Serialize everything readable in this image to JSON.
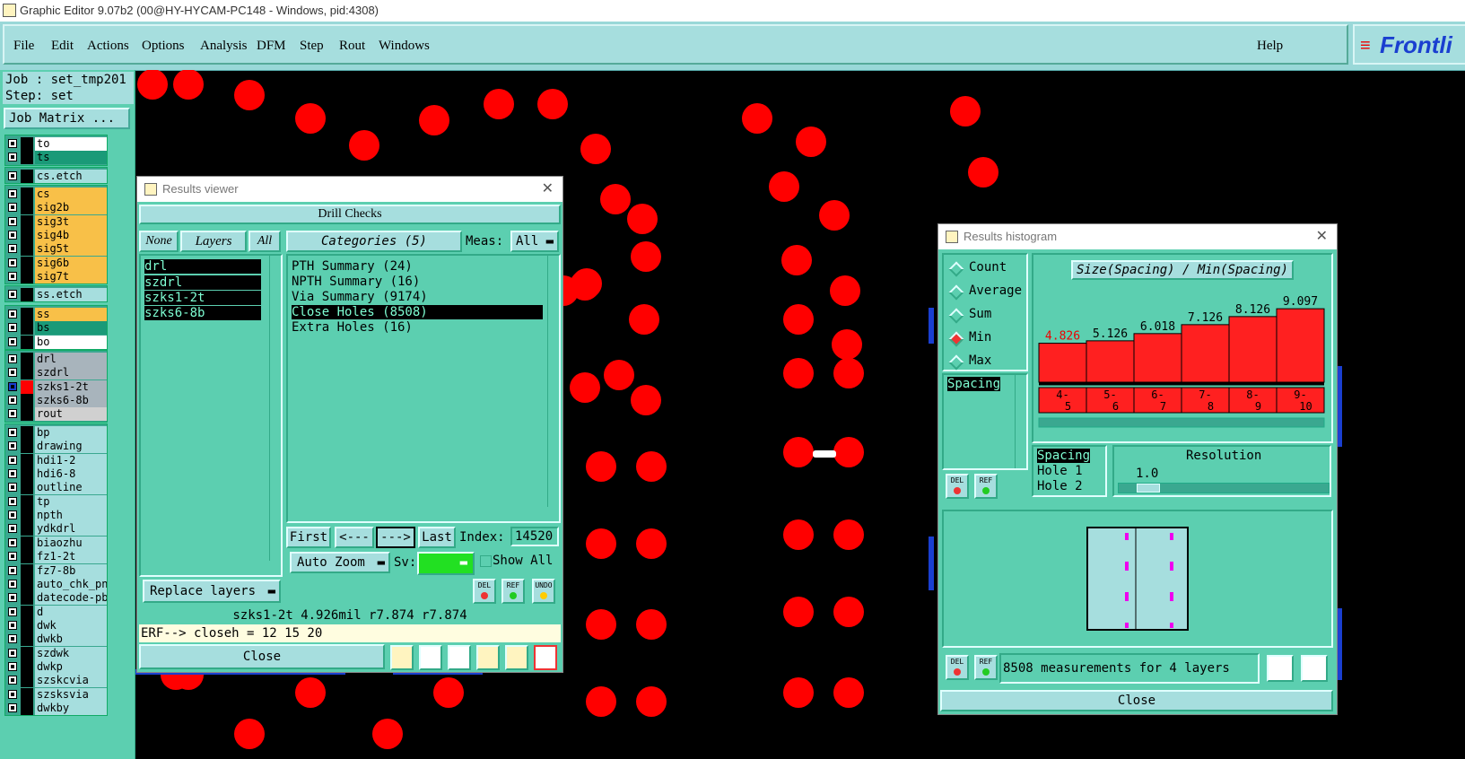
{
  "window_title": "Graphic Editor 9.07b2 (00@HY-HYCAM-PC148 - Windows, pid:4308)",
  "menu": [
    "File",
    "Edit",
    "Actions",
    "Options",
    "Analysis",
    "DFM",
    "Step",
    "Rout",
    "Windows"
  ],
  "help_label": "Help",
  "logo_text": "Frontli",
  "job_line": "Job : set_tmp201",
  "step_line": "Step: set",
  "job_matrix_label": "Job Matrix ...",
  "layers": [
    {
      "name": "to",
      "color": "#ffffff"
    },
    {
      "name": "ts",
      "color": "#1a9a78"
    },
    {
      "name": "cs.etch",
      "color": "#a6dede"
    },
    {
      "name": "cs",
      "color": "#f8c048"
    },
    {
      "name": "sig2b",
      "color": "#f8c048"
    },
    {
      "name": "sig3t",
      "color": "#f8c048"
    },
    {
      "name": "sig4b",
      "color": "#f8c048"
    },
    {
      "name": "sig5t",
      "color": "#f8c048"
    },
    {
      "name": "sig6b",
      "color": "#f8c048"
    },
    {
      "name": "sig7t",
      "color": "#f8c048"
    },
    {
      "name": "ss.etch",
      "color": "#a6dede"
    },
    {
      "name": "ss",
      "color": "#f8c048"
    },
    {
      "name": "bs",
      "color": "#1a9a78"
    },
    {
      "name": "bo",
      "color": "#ffffff"
    },
    {
      "name": "drl",
      "color": "#a8b4bc"
    },
    {
      "name": "szdrl",
      "color": "#a8b4bc"
    },
    {
      "name": "szks1-2t",
      "color": "#a8b4bc"
    },
    {
      "name": "szks6-8b",
      "color": "#a8b4bc"
    },
    {
      "name": "rout",
      "color": "#d0d0d0"
    },
    {
      "name": "bp",
      "color": "#a6dede"
    },
    {
      "name": "drawing",
      "color": "#a6dede"
    },
    {
      "name": "hdi1-2",
      "color": "#a6dede"
    },
    {
      "name": "hdi6-8",
      "color": "#a6dede"
    },
    {
      "name": "outline",
      "color": "#a6dede"
    },
    {
      "name": "tp",
      "color": "#a6dede"
    },
    {
      "name": "npth",
      "color": "#a6dede"
    },
    {
      "name": "ydkdrl",
      "color": "#a6dede"
    },
    {
      "name": "biaozhu",
      "color": "#a6dede"
    },
    {
      "name": "fz1-2t",
      "color": "#a6dede"
    },
    {
      "name": "fz7-8b",
      "color": "#a6dede"
    },
    {
      "name": "auto_chk_pni",
      "color": "#a6dede"
    },
    {
      "name": "datecode-pbe",
      "color": "#a6dede"
    },
    {
      "name": "d",
      "color": "#a6dede"
    },
    {
      "name": "dwk",
      "color": "#a6dede"
    },
    {
      "name": "dwkb",
      "color": "#a6dede"
    },
    {
      "name": "szdwk",
      "color": "#a6dede"
    },
    {
      "name": "dwkp",
      "color": "#a6dede"
    },
    {
      "name": "szskcvia",
      "color": "#a6dede"
    },
    {
      "name": "szsksvia",
      "color": "#a6dede"
    },
    {
      "name": "dwkby",
      "color": "#a6dede"
    }
  ],
  "results_viewer": {
    "title": "Results viewer",
    "header": "Drill Checks",
    "none_label": "None",
    "layers_label": "Layers",
    "all_label": "All",
    "categories_label": "Categories (5)",
    "meas_label": "Meas:",
    "meas_value": "All",
    "layer_list": [
      "drl",
      "szdrl",
      "szks1-2t",
      "szks6-8b"
    ],
    "category_list": [
      "PTH Summary (24)",
      "NPTH Summary (16)",
      "Via Summary (9174)",
      "Close Holes (8508)",
      "Extra Holes (16)"
    ],
    "selected_category": 3,
    "first_label": "First",
    "prev_label": "<---",
    "next_label": "--->",
    "last_label": "Last",
    "index_label": "Index:",
    "index_value": "14520",
    "auto_zoom_label": "Auto Zoom",
    "sv_label": "Sv:",
    "show_all_label": "Show All",
    "replace_layers_label": "Replace layers",
    "del_label": "DEL",
    "ref_label": "REF",
    "undo_label": "UNDO",
    "info_line": "szks1-2t 4.926mil  r7.874  r7.874",
    "erf_line": "ERF--> closeh = 12 15 20",
    "close_label": "Close"
  },
  "histogram": {
    "title": "Results histogram",
    "modes": [
      "Count",
      "Average",
      "Sum",
      "Min",
      "Max"
    ],
    "selected_mode": 3,
    "list_item": "Spacing",
    "chart_title": "Size(Spacing) / Min(Spacing)",
    "bins": [
      "4-\n5",
      "5-\n6",
      "6-\n7",
      "7-\n8",
      "8-\n9",
      "9-\n10"
    ],
    "bin_labels_top": [
      "4-",
      "5-",
      "6-",
      "7-",
      "8-",
      "9-"
    ],
    "bin_labels_bottom": [
      "5",
      "6",
      "7",
      "8",
      "9",
      "10"
    ],
    "bar_values": [
      "4.826",
      "5.126",
      "6.018",
      "7.126",
      "8.126",
      "9.097"
    ],
    "bar_heights": [
      4.826,
      5.126,
      6.018,
      7.126,
      8.126,
      9.097
    ],
    "sel_list": [
      "Spacing",
      "Hole 1",
      "Hole 2"
    ],
    "resolution_label": "Resolution",
    "resolution_value": "1.0",
    "measurement_text": "8508 measurements for 4 layers",
    "close_label": "Close",
    "del_label": "DEL",
    "ref_label": "REF"
  },
  "colors": {
    "pad": "#ff0000",
    "panel": "#5ccfb0",
    "button": "#a6dede"
  }
}
